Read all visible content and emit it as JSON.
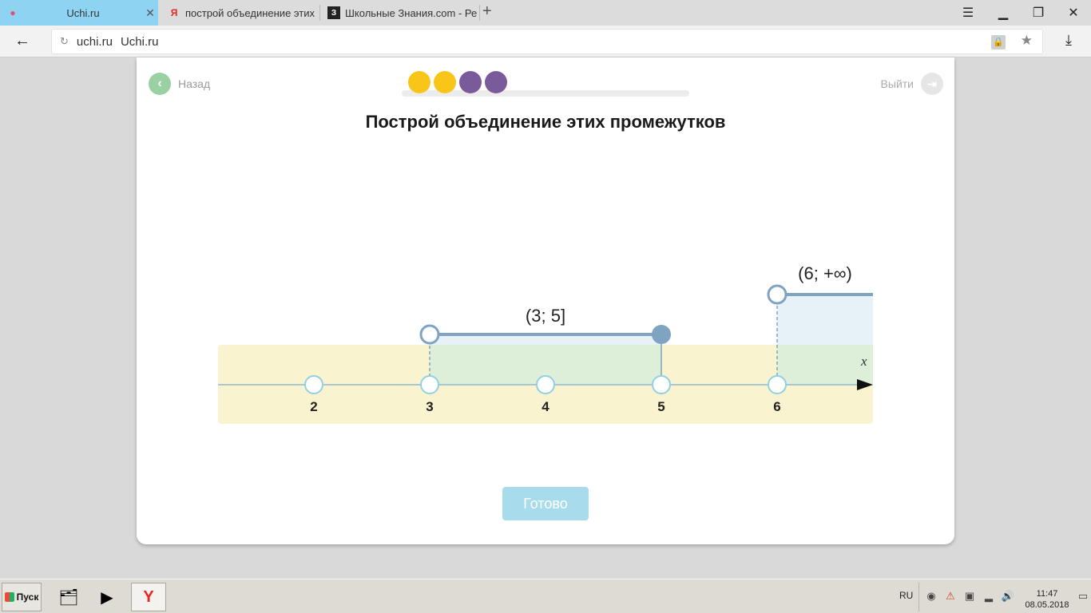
{
  "browser": {
    "tabs": [
      {
        "title": "Uchi.ru",
        "favicon": "uchi-icon",
        "active": true
      },
      {
        "title": "построй объединение этих п",
        "favicon": "yandex-icon",
        "active": false
      },
      {
        "title": "Школьные Знания.com - Ре",
        "favicon": "znanija-icon",
        "active": false
      }
    ],
    "address": {
      "domain": "uchi.ru",
      "page_title": "Uchi.ru"
    }
  },
  "lesson": {
    "back_label": "Назад",
    "exit_label": "Выйти",
    "progress_dots": [
      {
        "state": "done",
        "color": "#f8c518"
      },
      {
        "state": "done",
        "color": "#f8c518"
      },
      {
        "state": "todo",
        "color": "#7a5a9b"
      },
      {
        "state": "todo",
        "color": "#7a5a9b"
      }
    ],
    "heading": "Построй объединение этих промежутков",
    "axis_label": "x",
    "ticks": [
      {
        "value": "2",
        "state": "open"
      },
      {
        "value": "3",
        "state": "open"
      },
      {
        "value": "4",
        "state": "open"
      },
      {
        "value": "5",
        "state": "open"
      },
      {
        "value": "6",
        "state": "open"
      }
    ],
    "intervals": [
      {
        "label": "(3; 5]",
        "from": 3,
        "to": 5,
        "from_closed": false,
        "to_closed": true
      },
      {
        "label": "(6; +∞)",
        "from": 6,
        "to": "+∞",
        "from_closed": false
      }
    ],
    "done_label": "Готово"
  },
  "taskbar": {
    "start_label": "Пуск",
    "lang": "RU",
    "time": "11:47",
    "date": "08.05.2018"
  },
  "colors": {
    "active_tab": "#8fd3f3",
    "back_button": "#9bd0a3",
    "done_button": "#a8dcec",
    "axis_band": "#faf3cf",
    "interval_fill": "#e3f0f7",
    "interval_line": "#7fa3c2"
  }
}
